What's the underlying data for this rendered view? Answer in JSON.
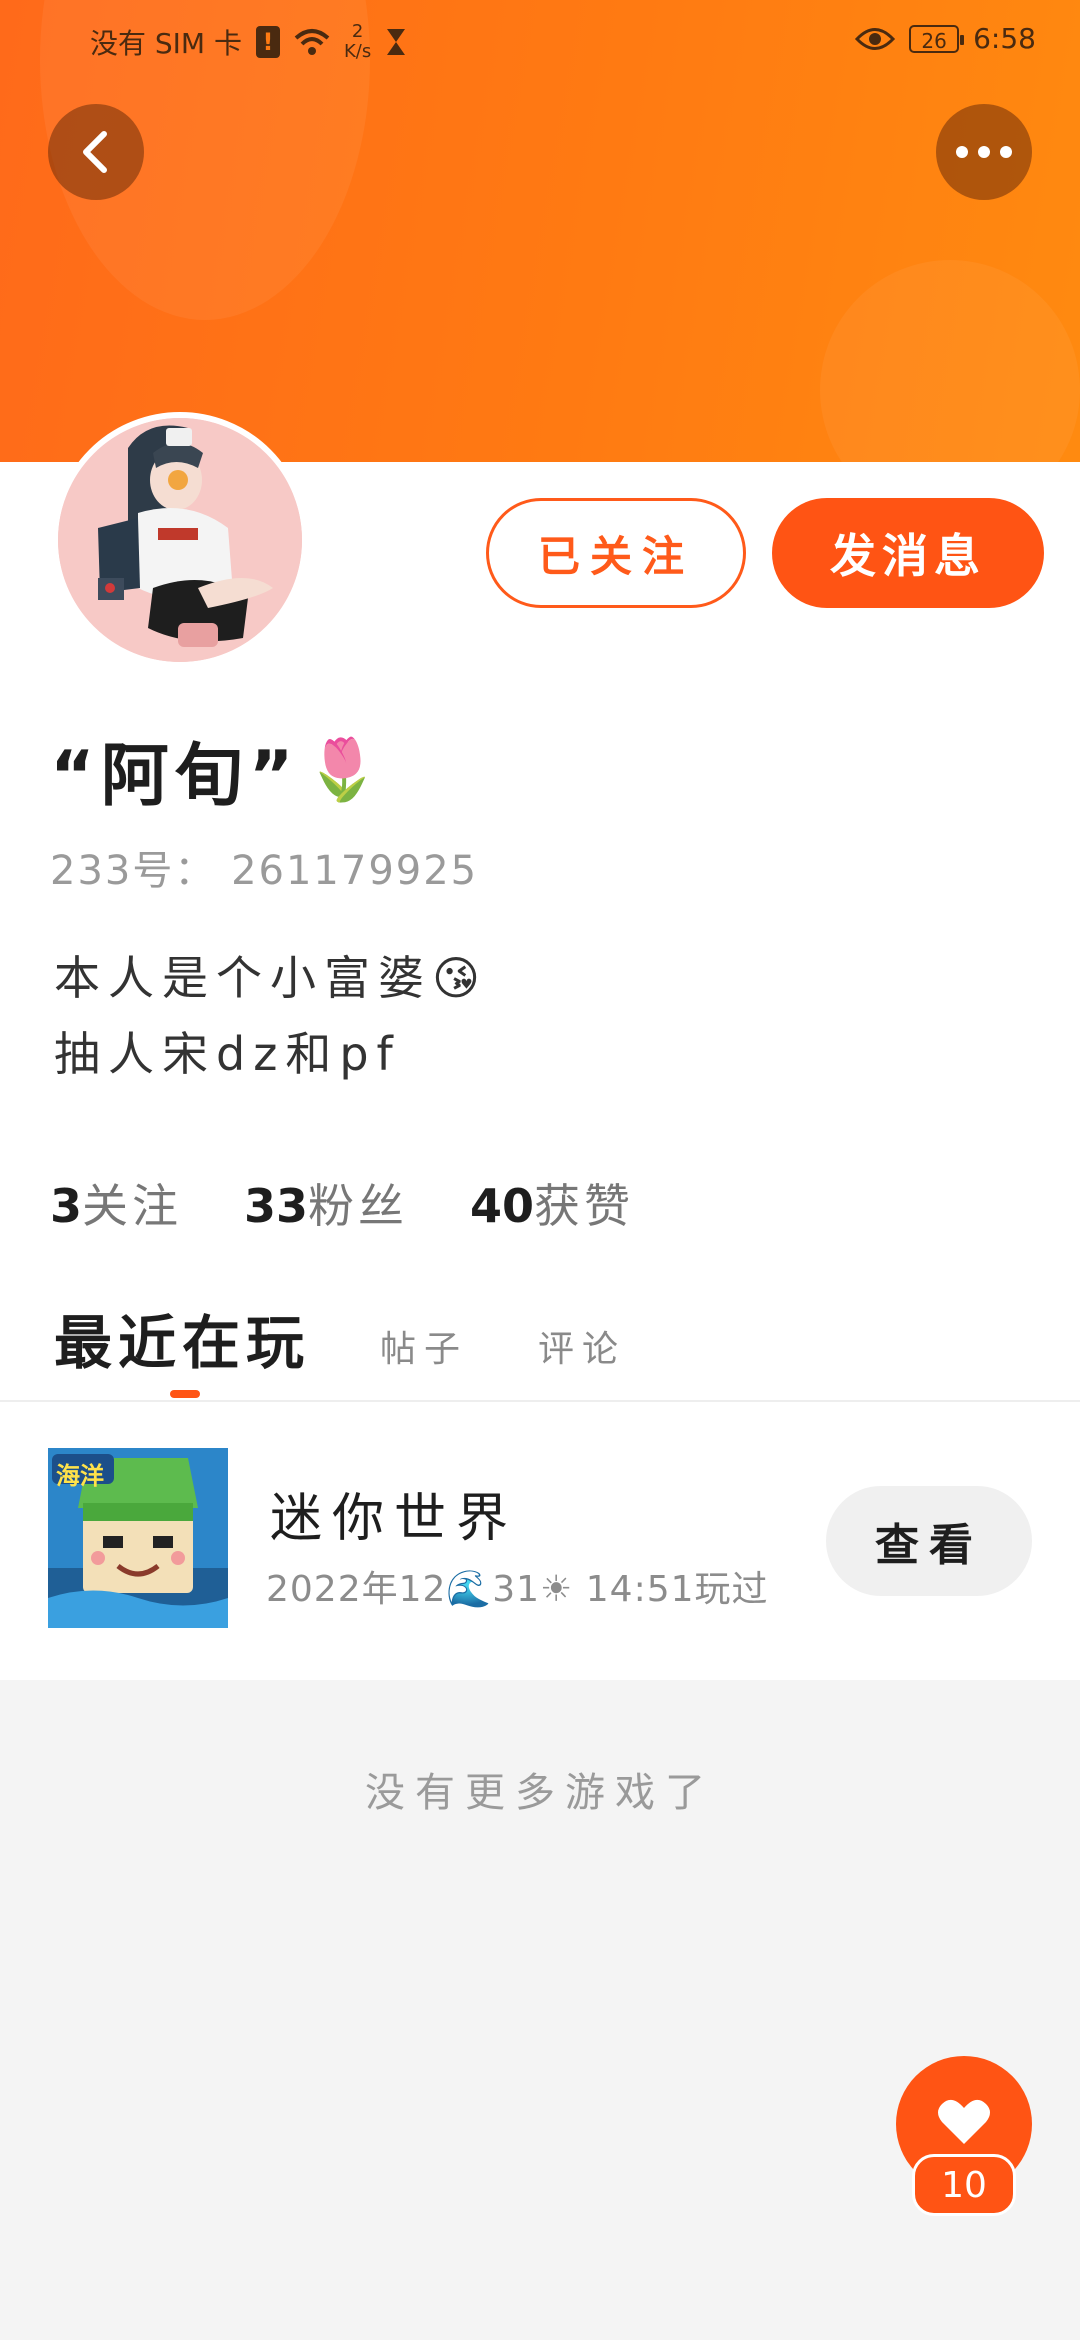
{
  "status_bar": {
    "carrier": "没有 SIM 卡",
    "net_speed_value": "2",
    "net_speed_unit": "K/s",
    "battery": "26",
    "time": "6:58"
  },
  "header": {
    "back_icon": "chevron-left-icon",
    "more_icon": "ellipsis-icon"
  },
  "profile": {
    "name": "“阿旬”",
    "name_emoji": "🌷",
    "id_label": "233号：",
    "id_value": "261179925",
    "bio_line1": "本人是个小富婆😘",
    "bio_line2": "抽人宋dz和pf"
  },
  "actions": {
    "follow_label": "已关注",
    "message_label": "发消息"
  },
  "stats": {
    "following_count": "3",
    "following_label": "关注",
    "fans_count": "33",
    "fans_label": "粉丝",
    "likes_count": "40",
    "likes_label": "获赞"
  },
  "tabs": {
    "active": "最近在玩",
    "posts": "帖子",
    "comments": "评论"
  },
  "game": {
    "badge": "海洋",
    "title": "迷你世界",
    "played_time": "2022年12🌊31☀ 14:51玩过",
    "view_label": "查看"
  },
  "footer": {
    "no_more": "没有更多游戏了"
  },
  "fab": {
    "icon": "heart-icon",
    "count": "10"
  },
  "colors": {
    "accent": "#ff5414",
    "header_gradient_start": "#ff6a1a",
    "header_gradient_end": "#ff8a10"
  }
}
